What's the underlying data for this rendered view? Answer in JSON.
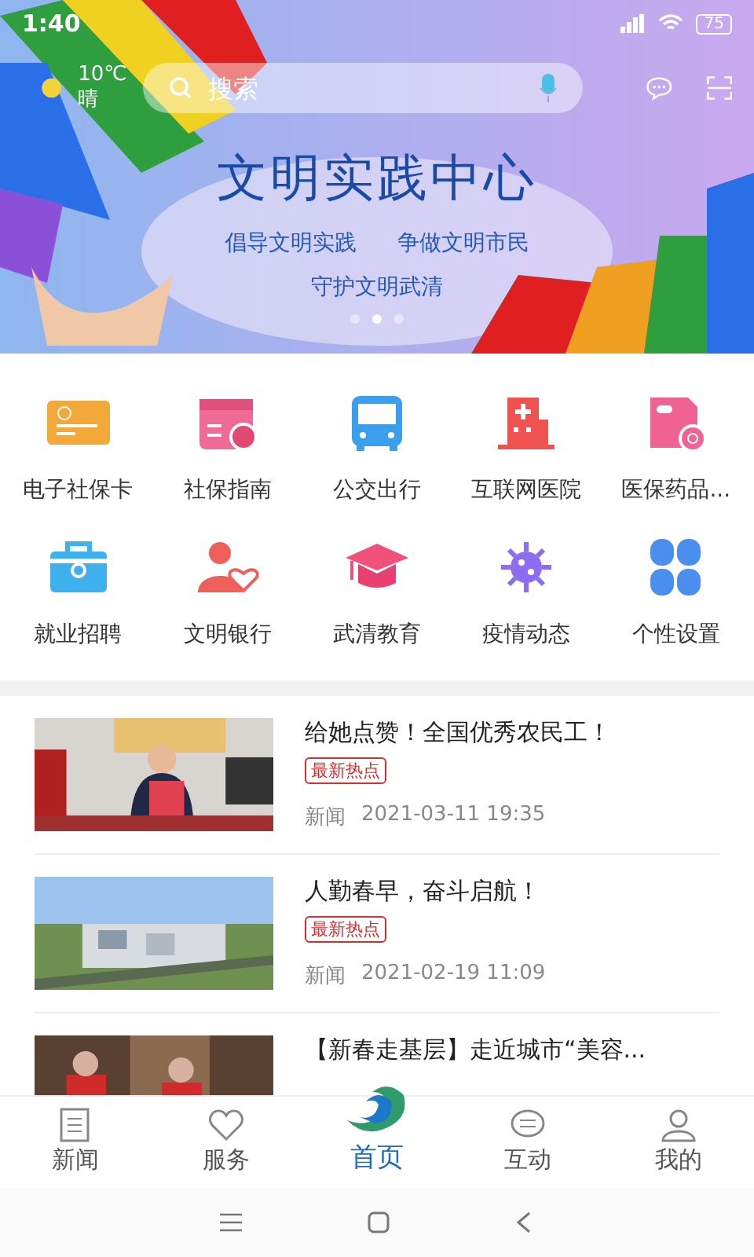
{
  "status_bar": {
    "time": "1:40",
    "battery": "75"
  },
  "header": {
    "temperature": "10℃",
    "weather": "晴",
    "search": {
      "placeholder": "搜索"
    }
  },
  "banner": {
    "title": "文明实践中心",
    "slogans": [
      "倡导文明实践",
      "争做文明市民",
      "守护文明武清"
    ],
    "dots": [
      {
        "selected": false
      },
      {
        "selected": true
      },
      {
        "selected": false
      }
    ]
  },
  "services": [
    {
      "label": "电子社保卡",
      "kind": "card"
    },
    {
      "label": "社保指南",
      "kind": "calendar"
    },
    {
      "label": "公交出行",
      "kind": "bus"
    },
    {
      "label": "互联网医院",
      "kind": "hospital"
    },
    {
      "label": "医保药品...",
      "kind": "medicine"
    },
    {
      "label": "就业招聘",
      "kind": "briefcase"
    },
    {
      "label": "文明银行",
      "kind": "person"
    },
    {
      "label": "武清教育",
      "kind": "cap"
    },
    {
      "label": "疫情动态",
      "kind": "virus"
    },
    {
      "label": "个性设置",
      "kind": "clover"
    }
  ],
  "news": [
    {
      "title": "给她点赞！全国优秀农民工！",
      "tag": "最新热点",
      "category": "新闻",
      "date": "2021-03-11 19:35"
    },
    {
      "title": "人勤春早，奋斗启航！",
      "tag": "最新热点",
      "category": "新闻",
      "date": "2021-02-19 11:09"
    },
    {
      "title": "【新春走基层】走近城市“美容..."
    }
  ],
  "nav": [
    {
      "label": "新闻",
      "kind": "news",
      "selected": false
    },
    {
      "label": "服务",
      "kind": "heart",
      "selected": false
    },
    {
      "label": "首页",
      "kind": "logo",
      "selected": true
    },
    {
      "label": "互动",
      "kind": "chat",
      "selected": false
    },
    {
      "label": "我的",
      "kind": "user",
      "selected": false
    }
  ]
}
